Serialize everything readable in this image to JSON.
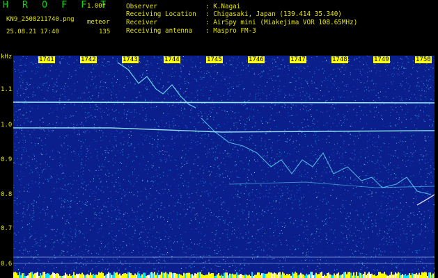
{
  "header": {
    "title": "H R O F F T",
    "version": "1.00f",
    "filename": "KN9_2508211740.png",
    "mode": "meteor",
    "datetime": "25.08.21 17:40",
    "count": "135"
  },
  "observer_info": [
    {
      "key": "Observer",
      "value": ": K.Nagai"
    },
    {
      "key": "Receiving Location",
      "value": ": Chigasaki, Japan (139.414 35.340)"
    },
    {
      "key": "Receiver",
      "value": ": AirSpy mini (Miakejima VOR 108.65MHz)"
    },
    {
      "key": "Receiving antenna",
      "value": ": Maspro FM-3"
    }
  ],
  "axis": {
    "unit": "kHz",
    "y_ticks": [
      "1.1",
      "1.0",
      "0.9",
      "0.8",
      "0.7",
      "0.6"
    ],
    "x_ticks": [
      "1741",
      "1742",
      "1743",
      "1744",
      "1745",
      "1746",
      "1747",
      "1748",
      "1749",
      "1750"
    ]
  },
  "colors": {
    "background": "#0a1e8c",
    "noise": "#00d2ff",
    "signal": "#aaffff",
    "header_text": "#e6e600",
    "title_text": "#00e000",
    "tick_label_bg": "#ffff00"
  }
}
